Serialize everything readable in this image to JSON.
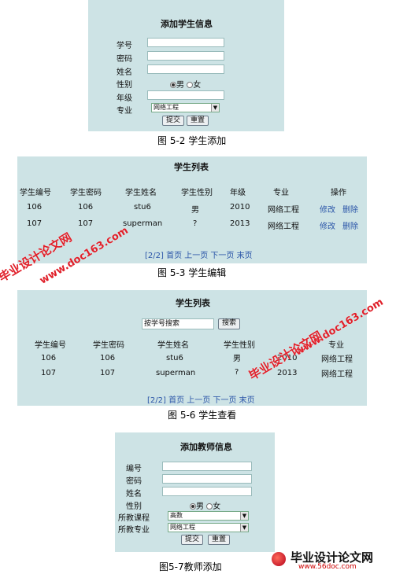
{
  "fig1": {
    "title": "添加学生信息",
    "labels": [
      "学号",
      "密码",
      "姓名",
      "性别",
      "年级",
      "专业"
    ],
    "gender_male": "男",
    "gender_female": "女",
    "major_value": "网络工程",
    "submit": "提交",
    "reset": "重置",
    "caption": "图 5-2 学生添加"
  },
  "fig2": {
    "title": "学生列表",
    "headers": [
      "学生编号",
      "学生密码",
      "学生姓名",
      "学生性别",
      "年级",
      "专业",
      "操作"
    ],
    "rows": [
      [
        "106",
        "106",
        "stu6",
        "男",
        "2010",
        "网络工程"
      ],
      [
        "107",
        "107",
        "superman",
        "?",
        "2013",
        "网络工程"
      ]
    ],
    "edit": "修改",
    "delete": "删除",
    "pager": "[2/2] 首页 上一页 下一页 末页",
    "caption": "图 5-3 学生编辑"
  },
  "fig3": {
    "title": "学生列表",
    "search_placeholder": "按学号搜索",
    "search_btn": "搜索",
    "headers": [
      "学生编号",
      "学生密码",
      "学生姓名",
      "学生性别",
      "年级",
      "专业"
    ],
    "rows": [
      [
        "106",
        "106",
        "stu6",
        "男",
        "2010",
        "网络工程"
      ],
      [
        "107",
        "107",
        "superman",
        "?",
        "2013",
        "网络工程"
      ]
    ],
    "pager": "[2/2] 首页 上一页 下一页 末页",
    "caption": "图 5-6 学生查看"
  },
  "fig4": {
    "title": "添加教师信息",
    "labels": [
      "编号",
      "密码",
      "姓名",
      "性别",
      "所教课程",
      "所教专业"
    ],
    "gender_male": "男",
    "gender_female": "女",
    "course_value": "高数",
    "major_value": "网络工程",
    "submit": "提交",
    "reset": "重置",
    "caption": "图5-7教师添加"
  },
  "watermarks": {
    "site_cn": "毕业设计论文网",
    "site_url": "www.doc163.com",
    "logo_cn": "毕业设计论文网",
    "logo_url": "www.56doc.com"
  }
}
